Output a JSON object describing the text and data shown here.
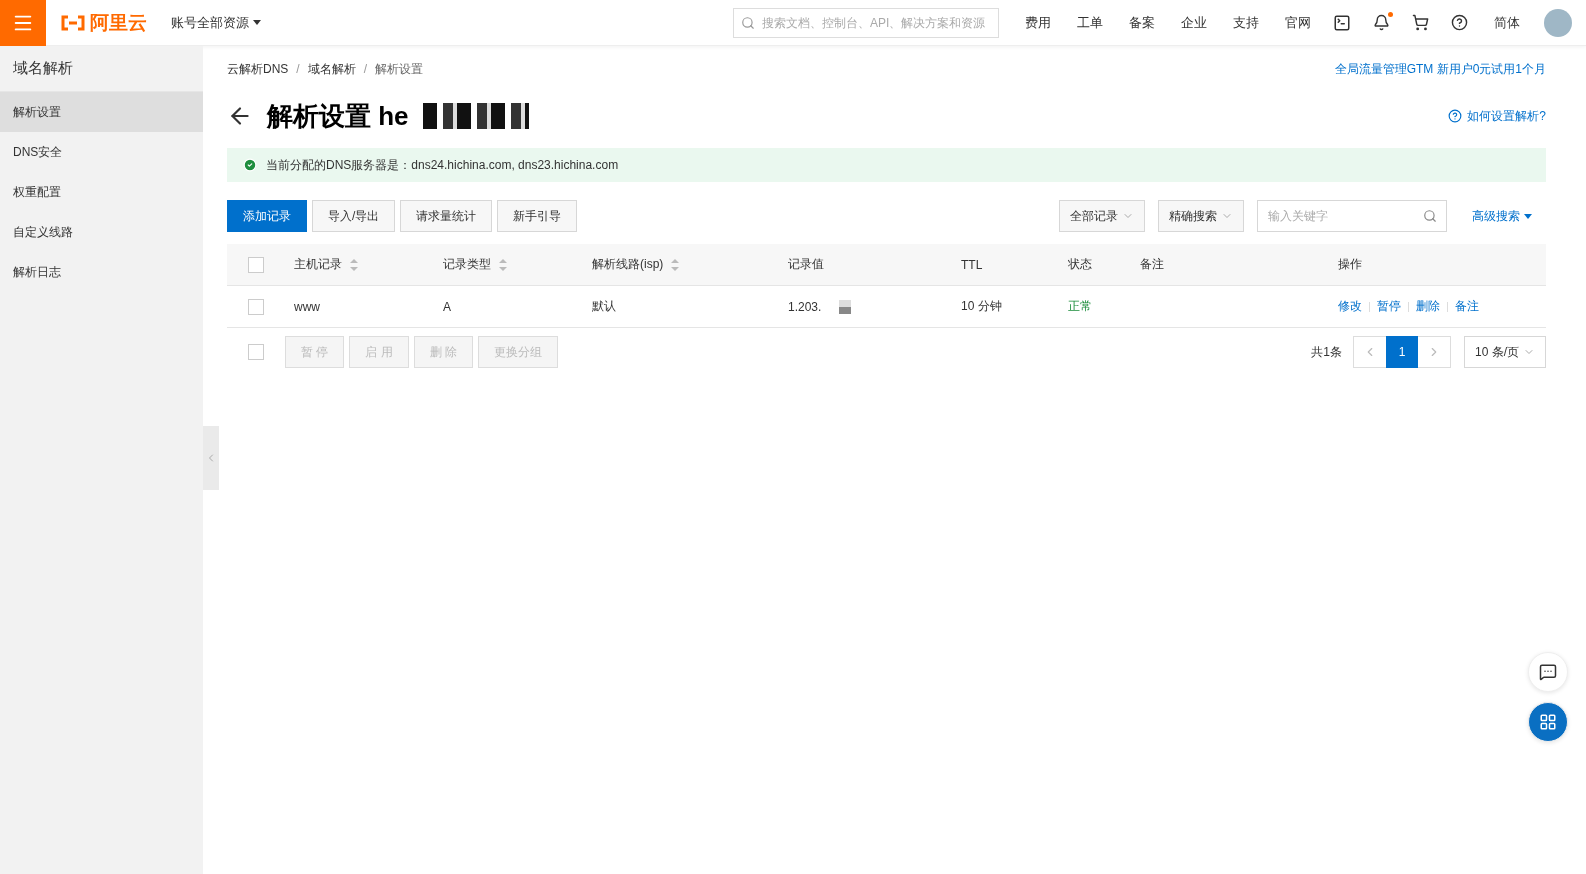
{
  "topbar": {
    "logo": "阿里云",
    "account": "账号全部资源",
    "search": {
      "placeholder": "搜索文档、控制台、API、解决方案和资源"
    },
    "nav": [
      "费用",
      "工单",
      "备案",
      "企业",
      "支持",
      "官网"
    ],
    "has_notification": true,
    "language": "简体"
  },
  "sidebar": {
    "title": "域名解析",
    "items": [
      {
        "label": "解析设置",
        "selected": true
      },
      {
        "label": "DNS安全",
        "selected": false
      },
      {
        "label": "权重配置",
        "selected": false
      },
      {
        "label": "自定义线路",
        "selected": false
      },
      {
        "label": "解析日志",
        "selected": false
      }
    ]
  },
  "breadcrumb": [
    {
      "label": "云解析DNS"
    },
    {
      "separator": "/",
      "label": "域名解析"
    },
    {
      "separator": "/",
      "label": "解析设置"
    }
  ],
  "promo_link": "全局流量管理GTM 新用户0元试用1个月",
  "page_title": "解析设置 he",
  "help_link": "如何设置解析?",
  "notice": "当前分配的DNS服务器是：dns24.hichina.com, dns23.hichina.com",
  "actions": [
    {
      "label": "添加记录",
      "primary": true
    },
    {
      "label": "导入/导出",
      "primary": false
    },
    {
      "label": "请求量统计",
      "primary": false
    },
    {
      "label": "新手引导",
      "primary": false
    }
  ],
  "filters": {
    "record_filter": "全部记录",
    "search_mode": "精确搜索",
    "keyword": {
      "placeholder": "输入关键字"
    },
    "advanced": "高级搜索"
  },
  "table": {
    "header_checked": false,
    "columns": [
      {
        "label": "主机记录",
        "sortable": true
      },
      {
        "label": "记录类型",
        "sortable": true
      },
      {
        "label": "解析线路(isp)",
        "sortable": true
      },
      {
        "label": "记录值",
        "sortable": false
      },
      {
        "label": "TTL",
        "sortable": false
      },
      {
        "label": "状态",
        "sortable": false
      },
      {
        "label": "备注",
        "sortable": false
      },
      {
        "label": "操作",
        "sortable": false
      }
    ],
    "rows": [
      {
        "host": "www",
        "type": "A",
        "line": "默认",
        "value": "1.203.",
        "ttl": "10 分钟",
        "status": "正常",
        "checked": false,
        "ops": [
          "修改",
          "暂停",
          "删除",
          "备注"
        ]
      }
    ]
  },
  "batch": {
    "checked": false,
    "buttons": [
      "暂 停",
      "启 用",
      "删 除",
      "更换分组"
    ]
  },
  "pagination": {
    "total": "共1条",
    "pages": [
      {
        "label": "1",
        "selected": true
      }
    ],
    "page_size": "10 条/页"
  }
}
